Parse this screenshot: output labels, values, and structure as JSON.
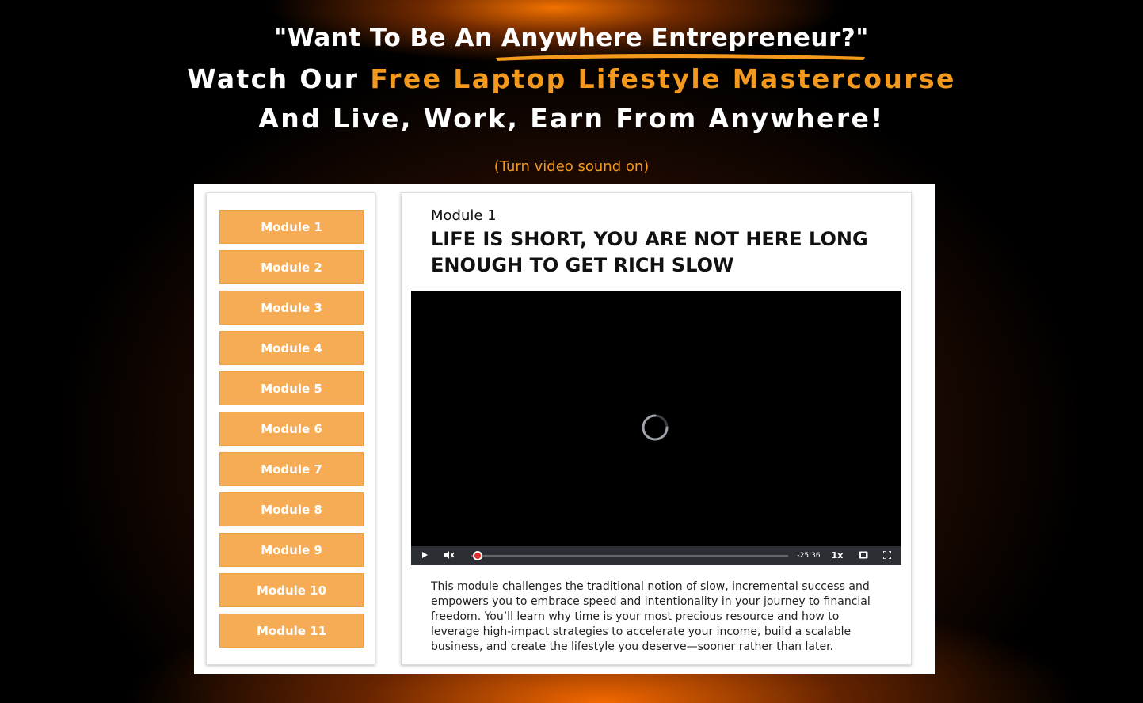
{
  "headline": {
    "line1": "\"Want To Be An Anywhere Entrepreneur?\"",
    "line2_prefix": "Watch Our ",
    "line2_highlight": "Free Laptop Lifestyle Mastercourse",
    "line3": "And Live, Work, Earn From Anywhere!"
  },
  "sound_note": "(Turn video sound on)",
  "sidebar": {
    "modules": [
      {
        "label": "Module 1"
      },
      {
        "label": "Module 2"
      },
      {
        "label": "Module 3"
      },
      {
        "label": "Module 4"
      },
      {
        "label": "Module 5"
      },
      {
        "label": "Module 6"
      },
      {
        "label": "Module 7"
      },
      {
        "label": "Module 8"
      },
      {
        "label": "Module 9"
      },
      {
        "label": "Module 10"
      },
      {
        "label": "Module 11"
      }
    ]
  },
  "content": {
    "module_label": "Module 1",
    "title": "LIFE IS SHORT, YOU ARE NOT HERE LONG ENOUGH TO GET RICH SLOW",
    "description": "This module challenges the traditional notion of slow, incremental success and empowers you to embrace speed and intentionality in your journey to financial freedom. You’ll learn why time is your most precious resource and how to leverage high-impact strategies to accelerate your income, build a scalable business, and create the lifestyle you deserve—sooner rather than later."
  },
  "video": {
    "time_remaining": "-25:36",
    "speed": "1x",
    "progress_fraction": 0.02,
    "icons": [
      "play-icon",
      "muted-speaker-icon",
      "hd-icon",
      "fullscreen-icon",
      "loading-spinner-icon"
    ]
  },
  "colors": {
    "accent_orange": "#f39a1e",
    "module_button": "#f6ab55",
    "progress_red": "#e02f2f"
  }
}
